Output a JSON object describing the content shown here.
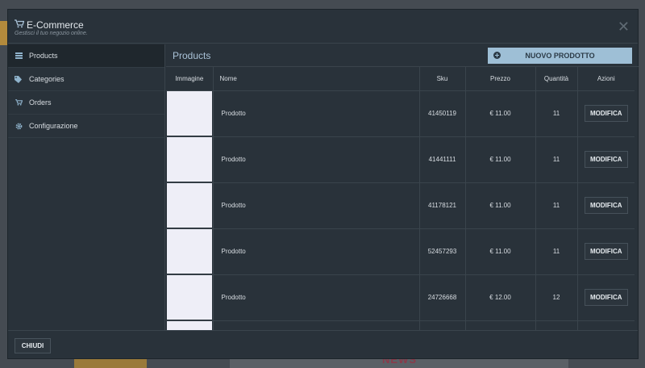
{
  "background": {
    "news_label": "NEWS"
  },
  "modal": {
    "title": "E-Commerce",
    "subtitle": "Gestisci il tuo negozio online.",
    "close_symbol": "✕"
  },
  "sidebar": {
    "items": [
      {
        "label": "Products",
        "icon": "list-icon",
        "active": true
      },
      {
        "label": "Categories",
        "icon": "tag-icon",
        "active": false
      },
      {
        "label": "Orders",
        "icon": "cart-icon",
        "active": false
      },
      {
        "label": "Configurazione",
        "icon": "gear-icon",
        "active": false
      }
    ]
  },
  "main": {
    "title": "Products",
    "new_product_label": "NUOVO PRODOTTO"
  },
  "table": {
    "headers": {
      "image": "Immagine",
      "name": "Nome",
      "sku": "Sku",
      "price": "Prezzo",
      "quantity": "Quantità",
      "actions": "Azioni"
    },
    "rows": [
      {
        "name": "Prodotto",
        "sku": "41450119",
        "price": "€ 11.00",
        "quantity": "11",
        "action": "MODIFICA"
      },
      {
        "name": "Prodotto",
        "sku": "41441111",
        "price": "€ 11.00",
        "quantity": "11",
        "action": "MODIFICA"
      },
      {
        "name": "Prodotto",
        "sku": "41178121",
        "price": "€ 11.00",
        "quantity": "11",
        "action": "MODIFICA"
      },
      {
        "name": "Prodotto",
        "sku": "52457293",
        "price": "€ 11.00",
        "quantity": "11",
        "action": "MODIFICA"
      },
      {
        "name": "Prodotto",
        "sku": "24726668",
        "price": "€ 12.00",
        "quantity": "12",
        "action": "MODIFICA"
      },
      {
        "name": "",
        "sku": "",
        "price": "",
        "quantity": "",
        "action": ""
      }
    ]
  },
  "footer": {
    "close_label": "CHIUDI"
  },
  "colors": {
    "modal_bg": "#29323a",
    "accent_button": "#9ebfd6",
    "title_blue": "#aac3d8"
  }
}
